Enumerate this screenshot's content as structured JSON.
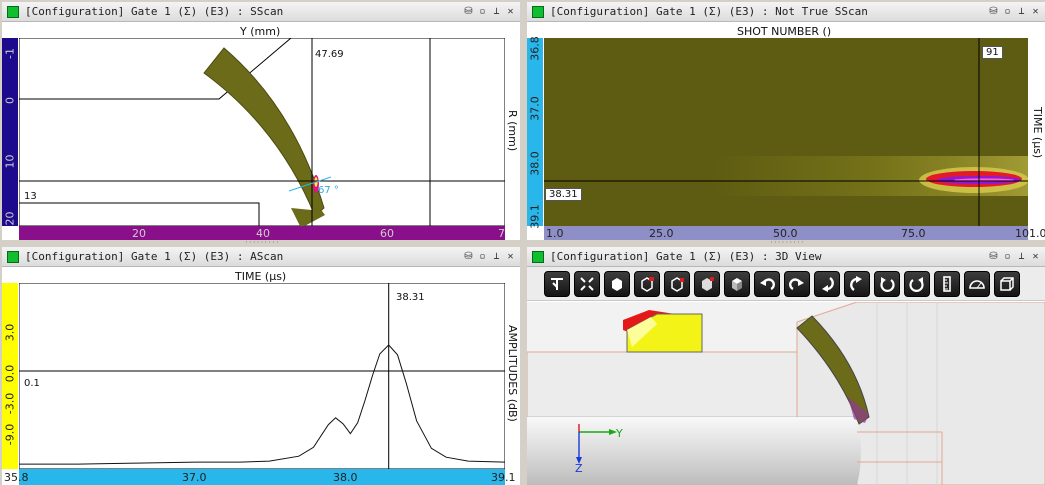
{
  "sscan": {
    "title": "[Configuration] Gate 1 (Σ) (E3) : SScan",
    "x_axis_title": "Y (mm)",
    "y_axis_title": "R (mm)",
    "y_ticks": [
      "-1",
      "0",
      "10",
      "20"
    ],
    "x_ticks": [
      "20",
      "40",
      "60",
      "7"
    ],
    "cursor_x_label": "47.69",
    "cursor_y_label": "13",
    "angle_label": "67 °",
    "colors": {
      "left_axis": "#1e0a8c",
      "bottom_axis": "#8a0f8a",
      "sector": "#6b6b1a"
    }
  },
  "nscan": {
    "title": "[Configuration] Gate 1 (Σ) (E3) : Not True SScan",
    "x_axis_title": "SHOT NUMBER ()",
    "y_axis_title": "TIME (µs)",
    "y_ticks": [
      "36.8",
      "37.0",
      "38.0",
      "39.1"
    ],
    "x_ticks": [
      "1.0",
      "25.0",
      "50.0",
      "75.0",
      "101.0"
    ],
    "cursor_x_label": "91",
    "cursor_y_label": "38.31",
    "colors": {
      "left_axis": "#29b6ea",
      "bottom_axis": "#8f8fc8",
      "background": "#5e5c12"
    }
  },
  "ascan": {
    "title": "[Configuration] Gate 1 (Σ) (E3) : AScan",
    "chart_data": {
      "type": "line",
      "title": "",
      "xlabel": "TIME (µs)",
      "ylabel": "AMPLITUDES (dB)",
      "x_ticks": [
        "35.8",
        "37.0",
        "38.0",
        "39.1"
      ],
      "y_ticks": [
        "3.0",
        "0.0",
        "-3.0",
        "-9.0"
      ],
      "xlim": [
        35.8,
        39.1
      ],
      "cursor_x": 38.31,
      "cursor_x_label": "38.31",
      "cursor_y_label": "0.1",
      "series": [
        {
          "x": [
            35.8,
            36.2,
            36.6,
            37.0,
            37.3,
            37.5,
            37.7,
            37.8,
            37.9,
            37.95,
            38.0,
            38.05,
            38.1,
            38.15,
            38.2,
            38.25,
            38.31,
            38.37,
            38.43,
            38.5,
            38.6,
            38.7,
            38.85,
            39.1
          ],
          "y": [
            -12.0,
            -12.0,
            -11.9,
            -11.8,
            -11.8,
            -11.7,
            -11.2,
            -10.3,
            -8.0,
            -7.3,
            -7.9,
            -8.9,
            -7.8,
            -5.5,
            -3.0,
            -0.8,
            0.1,
            -0.9,
            -3.8,
            -7.6,
            -10.4,
            -11.3,
            -11.7,
            -11.8
          ]
        }
      ],
      "colors": {
        "left_axis": "#ffff00",
        "bottom_axis": "#29b6ea"
      }
    }
  },
  "view3d": {
    "title": "[Configuration] Gate 1 (Σ) (E3) : 3D View",
    "toolbar": [
      "select-tool-icon",
      "fit-view-icon",
      "front-view-icon",
      "side-view-icon",
      "top-view-icon",
      "iso-view-icon",
      "3d-cube-icon",
      "rotate-left-icon",
      "rotate-right-icon",
      "rotate-down-icon",
      "rotate-up-icon",
      "rotate-ccw-icon",
      "rotate-cw-icon",
      "ruler-icon",
      "protractor-icon",
      "box-view-icon"
    ],
    "axes": {
      "y": "Y",
      "z": "Z"
    }
  }
}
